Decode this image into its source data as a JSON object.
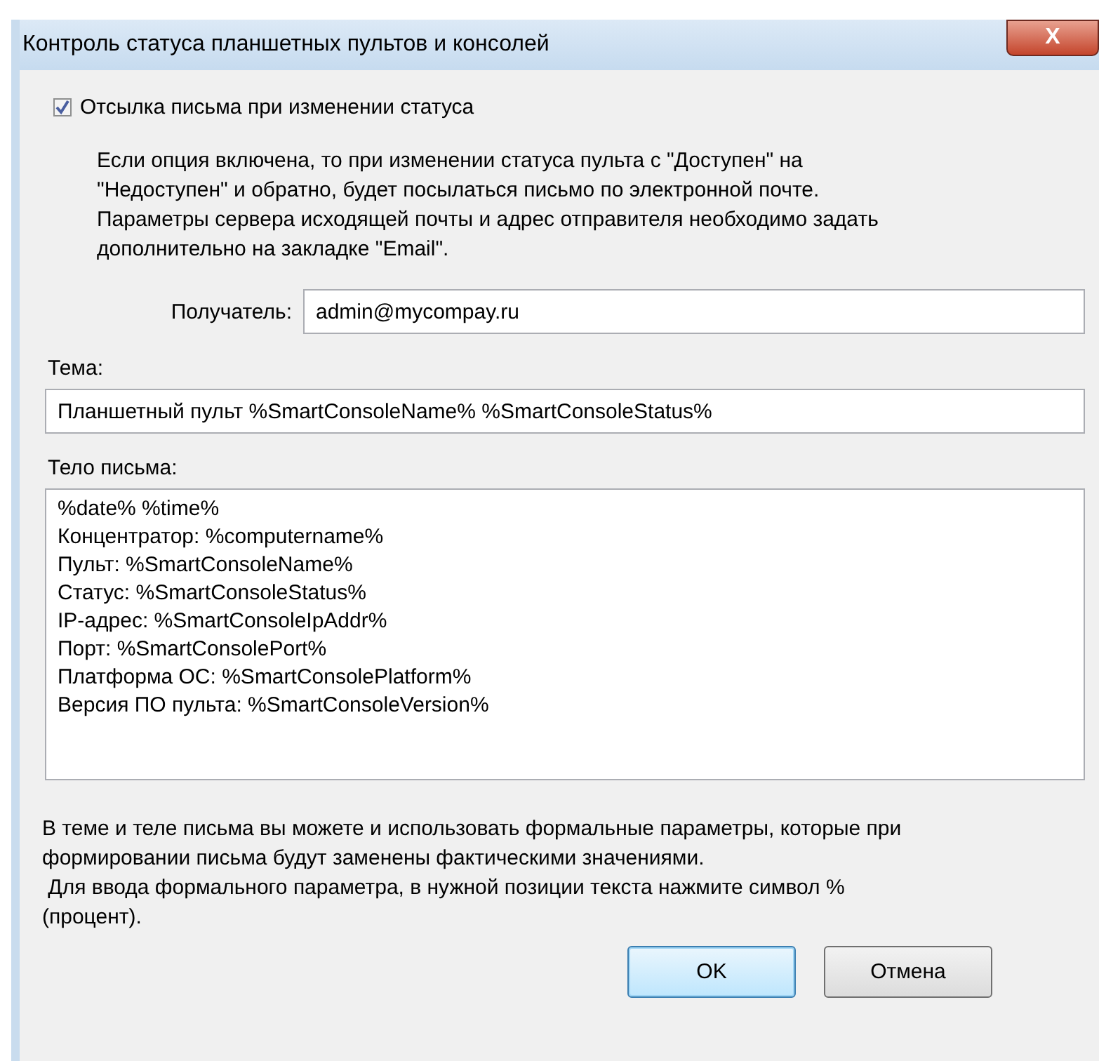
{
  "window": {
    "title": "Контроль статуса планшетных пультов и консолей",
    "close_label": "X"
  },
  "notify": {
    "label": "Отсылка письма при изменении статуса",
    "checked": true
  },
  "description": "Если опция включена, то при изменении статуса пульта с \"Доступен\" на\n\"Недоступен\" и обратно, будет посылаться письмо по электронной почте.\nПараметры сервера исходящей почты и адрес отправителя необходимо задать\nдополнительно на закладке \"Email\".",
  "recipient": {
    "label": "Получатель:",
    "value": "admin@mycompay.ru"
  },
  "subject": {
    "label": "Тема:",
    "value": "Планшетный пульт %SmartConsoleName% %SmartConsoleStatus%"
  },
  "body": {
    "label": "Тело письма:",
    "value": "%date% %time%\nКонцентратор: %computername%\nПульт: %SmartConsoleName%\nСтатус: %SmartConsoleStatus%\nIP-адрес: %SmartConsoleIpAddr%\nПорт: %SmartConsolePort%\nПлатформа ОС: %SmartConsolePlatform%\nВерсия ПО пульта: %SmartConsoleVersion%"
  },
  "hint": "В теме и теле письма вы можете и использовать формальные параметры, которые при\nформировании письма будут заменены фактическими значениями.\n Для ввода формального параметра, в нужной позиции текста нажмите символ %\n(процент).",
  "buttons": [
    {
      "label": "OK",
      "default": true
    },
    {
      "label": "Отмена",
      "default": false
    }
  ]
}
